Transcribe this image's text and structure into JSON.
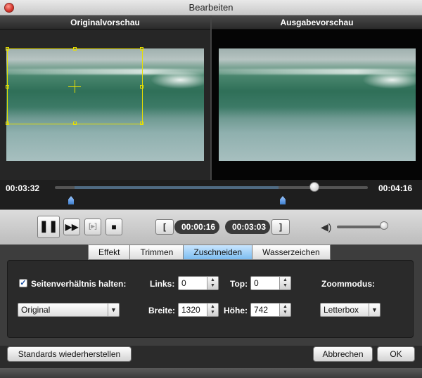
{
  "window": {
    "title": "Bearbeiten"
  },
  "preview": {
    "original_label": "Originalvorschau",
    "output_label": "Ausgabevorschau"
  },
  "timeline": {
    "current_time": "00:03:32",
    "total_time": "00:04:16"
  },
  "controls": {
    "pause_symbol": "❚❚",
    "forward_symbol": "▶▶",
    "clip_symbol": "[▸]",
    "stop_symbol": "■",
    "set_start_symbol": "[",
    "set_end_symbol": "]",
    "start_time": "00:00:16",
    "end_time": "00:03:03",
    "volume_symbol": "◀)"
  },
  "tabs": [
    {
      "label": "Effekt"
    },
    {
      "label": "Trimmen"
    },
    {
      "label": "Zuschneiden",
      "active": true
    },
    {
      "label": "Wasserzeichen"
    }
  ],
  "crop": {
    "keep_ratio_label": "Seitenverhältnis halten:",
    "keep_ratio_checked": true,
    "check_symbol": "✓",
    "links_label": "Links:",
    "links_value": "0",
    "top_label": "Top:",
    "top_value": "0",
    "zoom_label": "Zoommodus:",
    "zoom_value": "Letterbox",
    "ratio_value": "Original",
    "breite_label": "Breite:",
    "breite_value": "1320",
    "hoehe_label": "Höhe:",
    "hoehe_value": "742"
  },
  "buttons": {
    "reset_label": "Standards wiederherstellen",
    "cancel_label": "Abbrechen",
    "ok_label": "OK"
  },
  "colors": {
    "crop_box": "#e8e000",
    "active_tab": "#7cbcf0"
  }
}
